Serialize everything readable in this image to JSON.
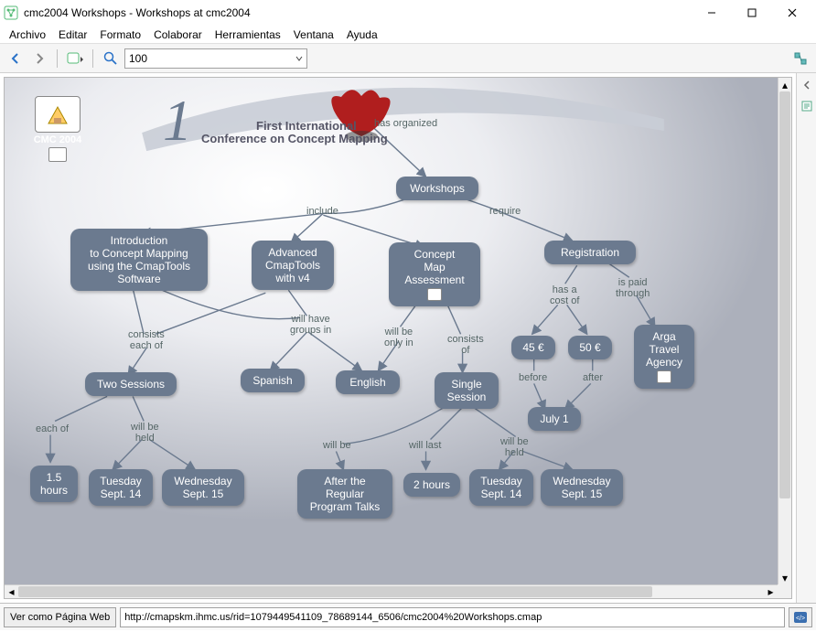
{
  "window": {
    "title": "cmc2004 Workshops - Workshops at cmc2004"
  },
  "menubar": {
    "items": [
      "Archivo",
      "Editar",
      "Formato",
      "Colaborar",
      "Herramientas",
      "Ventana",
      "Ayuda"
    ]
  },
  "toolbar": {
    "zoom_value": "100"
  },
  "sidebar_file": {
    "caption": "CMC 2004"
  },
  "logo": {
    "line1": "First International",
    "line2": "Conference on Concept Mapping"
  },
  "nodes": {
    "workshops": "Workshops",
    "intro": "Introduction\nto Concept Mapping\nusing the CmapTools\nSoftware",
    "advanced": "Advanced\nCmapTools\nwith v4",
    "assessment": "Concept\nMap\nAssessment",
    "registration": "Registration",
    "two_sessions": "Two Sessions",
    "spanish": "Spanish",
    "english": "English",
    "single_session": "Single\nSession",
    "cost45": "45 €",
    "cost50": "50 €",
    "arga": "Arga\nTravel\nAgency",
    "onefive": "1.5\nhours",
    "tue14a": "Tuesday\nSept. 14",
    "wed15a": "Wednesday\nSept. 15",
    "after": "After the\nRegular\nProgram Talks",
    "twohours": "2 hours",
    "tue14b": "Tuesday\nSept. 14",
    "wed15b": "Wednesday\nSept. 15",
    "july1": "July 1"
  },
  "links": {
    "has_organized": "has organized",
    "include": "include",
    "require": "require",
    "consists_each_of": "consists\neach of",
    "will_have_groups_in": "will have\ngroups in",
    "will_be_only_in": "will be\nonly in",
    "consists_of": "consists\nof",
    "has_cost_of": "has a\ncost of",
    "is_paid_through": "is paid\nthrough",
    "each_of": "each of",
    "will_be_held_a": "will be\nheld",
    "will_be": "will be",
    "will_last": "will last",
    "will_be_held_b": "will be\nheld",
    "before": "before",
    "after": "after"
  },
  "statusbar": {
    "view_as_web": "Ver como Página Web",
    "url": "http://cmapskm.ihmc.us/rid=1079449541109_78689144_6506/cmc2004%20Workshops.cmap"
  }
}
